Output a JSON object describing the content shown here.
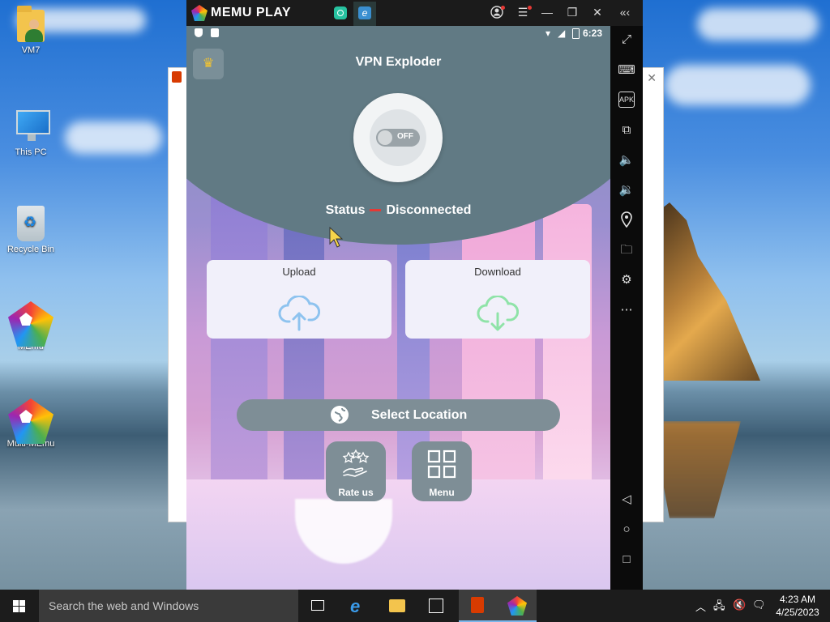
{
  "desktop": {
    "icons": [
      {
        "label": "VM7",
        "icon": "user-folder-icon"
      },
      {
        "label": "This PC",
        "icon": "computer-icon"
      },
      {
        "label": "Recycle Bin",
        "icon": "recycle-bin-icon"
      },
      {
        "label": "MEmu",
        "icon": "memu-icon"
      },
      {
        "label": "Multi-MEmu",
        "icon": "multi-memu-icon"
      }
    ]
  },
  "emulator": {
    "brand": "MEMU PLAY",
    "app_tabs": [
      "app-tab-icon",
      "browser-tab-icon"
    ],
    "controls": [
      "account-icon",
      "menu-icon",
      "minimize-icon",
      "restore-icon",
      "close-icon",
      "collapse-sidebar-icon"
    ],
    "sidebar": [
      "fullscreen-icon",
      "keyboard-icon",
      "apk-icon",
      "add-app-icon",
      "volume-up-icon",
      "volume-down-icon",
      "location-icon",
      "folder-icon",
      "settings-icon",
      "more-icon",
      "back-icon",
      "home-icon",
      "recents-icon"
    ]
  },
  "android": {
    "time": "6:23",
    "app": {
      "title": "VPN Exploder",
      "toggle_state": "OFF",
      "status_label": "Status",
      "status_value": "Disconnected",
      "upload_label": "Upload",
      "download_label": "Download",
      "select_location": "Select Location",
      "rate_us": "Rate us",
      "menu": "Menu"
    }
  },
  "taskbar": {
    "search_placeholder": "Search the web and Windows",
    "time": "4:23 AM",
    "date": "4/25/2023"
  },
  "colors": {
    "header": "#617a84",
    "button": "#7e8e96",
    "upload_icon": "#8ec3ef",
    "download_icon": "#8fe3a8",
    "taskbar": "#1c1c1c"
  }
}
